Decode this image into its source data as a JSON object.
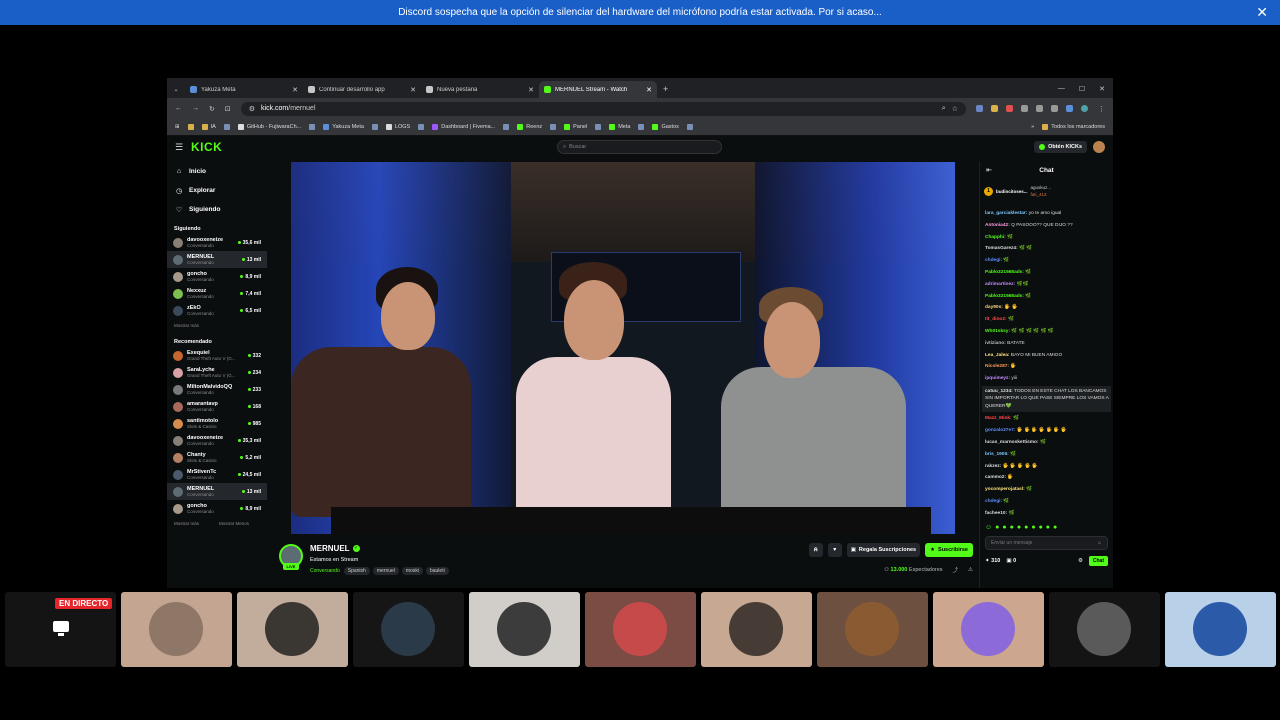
{
  "banner": {
    "text": "Discord sospecha que la opción de silenciar del hardware del micrófono podría estar activada. Por si acaso...",
    "close": "✕"
  },
  "browser": {
    "tabs": [
      {
        "label": "Yakuza Meta",
        "color": "#5b8fd9"
      },
      {
        "label": "Continuar desarrollo app",
        "color": "#c6c6c6"
      },
      {
        "label": "Nueva pestaña",
        "color": "#c6c6c6"
      },
      {
        "label": "MERNUEL Stream - Watch",
        "color": "#53fc18"
      }
    ],
    "tab_close": "✕",
    "new_tab": "+",
    "url": {
      "host": "kick.com",
      "path": "/mernuel"
    },
    "nav": {
      "back": "←",
      "forward": "→",
      "reload": "↻",
      "layout": "⊡",
      "menu": "⋮",
      "zoom": "⌕",
      "star": "☆"
    },
    "win": {
      "min": "—",
      "max": "☐",
      "close": "✕"
    },
    "bookmarks": [
      {
        "label": "IA",
        "color": "#d9b04a"
      },
      {
        "label": "GitHub - FujiwaraCh...",
        "color": "#ddd"
      },
      {
        "label": "Yakuza Meta",
        "color": "#5b8fd9"
      },
      {
        "label": "LOGS",
        "color": "#ddd"
      },
      {
        "label": "Dashboard | Fivema...",
        "color": "#9b59ff"
      },
      {
        "label": "Reenz",
        "color": "#53fc18"
      },
      {
        "label": "Panel",
        "color": "#53fc18"
      },
      {
        "label": "Meta",
        "color": "#53fc18"
      },
      {
        "label": "Gastos",
        "color": "#53fc18"
      }
    ],
    "bookmarks_all": "Todos los marcadores"
  },
  "kick": {
    "logo": "KICK",
    "search_placeholder": "Buscar",
    "get_kicks": "Obtén KICKs",
    "nav": [
      {
        "icon": "⌂",
        "label": "Inicio"
      },
      {
        "icon": "◷",
        "label": "Explorar"
      },
      {
        "icon": "♡",
        "label": "Siguiendo"
      }
    ],
    "following_title": "Siguiendo",
    "following": [
      {
        "name": "davooxeneize",
        "game": "Conversando",
        "viewers": "35,6 mil",
        "color": "#8a7f75",
        "active": false
      },
      {
        "name": "MERNUEL",
        "game": "Conversando",
        "viewers": "13 mil",
        "color": "#5d6b73",
        "active": true
      },
      {
        "name": "goncho",
        "game": "Conversando",
        "viewers": "8,9 mil",
        "color": "#a6988b",
        "active": false
      },
      {
        "name": "Nexxuz",
        "game": "Conversando",
        "viewers": "7,4 mil",
        "color": "#7fbf4d",
        "active": false
      },
      {
        "name": "zEkO",
        "game": "Conversando",
        "viewers": "6,5 mil",
        "color": "#3a4a5a",
        "active": false
      }
    ],
    "following_more": "Mostrar más",
    "recommended_title": "Recomendado",
    "recommended": [
      {
        "name": "Exequiel",
        "game": "Grand Theft Auto V (G...",
        "viewers": "332",
        "color": "#c4662e",
        "active": false
      },
      {
        "name": "SaraLyche",
        "game": "Grand Theft Auto V (G...",
        "viewers": "234",
        "color": "#d9a0a6",
        "active": false
      },
      {
        "name": "MiltonMalvidoQQ",
        "game": "Conversando",
        "viewers": "233",
        "color": "#7a7a7a",
        "active": false
      },
      {
        "name": "amarantavp",
        "game": "Conversando",
        "viewers": "168",
        "color": "#a8695b",
        "active": false
      },
      {
        "name": "santimotolo",
        "game": "Slots & Casino",
        "viewers": "985",
        "color": "#d88b4f",
        "active": false
      },
      {
        "name": "davooxeneize",
        "game": "Conversando",
        "viewers": "35,3 mil",
        "color": "#8a7f75",
        "active": false
      },
      {
        "name": "Chanty",
        "game": "Slots & Casino",
        "viewers": "5,2 mil",
        "color": "#b57f63",
        "active": false
      },
      {
        "name": "MrStivenTc",
        "game": "Conversando",
        "viewers": "24,5 mil",
        "color": "#4a5a6a",
        "active": false
      },
      {
        "name": "MERNUEL",
        "game": "Conversando",
        "viewers": "13 mil",
        "color": "#5d6b73",
        "active": true
      },
      {
        "name": "goncho",
        "game": "Conversando",
        "viewers": "8,9 mil",
        "color": "#a6988b",
        "active": false
      }
    ],
    "show_more": "Mostrar más",
    "show_less": "Mostrar Menos"
  },
  "stream": {
    "channel": "MERNUEL",
    "verified": "✓",
    "live_badge": "LIVE",
    "title": "Estamos en Stream",
    "category": "Conversando",
    "tags": [
      "Spanish",
      "mernuel",
      "moski",
      "bauleti"
    ],
    "gift_subs": "Regala Suscripciones",
    "subscribe": "Suscribirse",
    "viewers": "13.000",
    "viewers_label": "Espectadores",
    "share_icon": "⤴",
    "report_icon": "⚠",
    "bell_icon": "🔔",
    "heart_icon": "♥"
  },
  "chat": {
    "title": "Chat",
    "collapse_icon": "⇤",
    "pinned": [
      {
        "user": "budincitoses...",
        "rank": "1",
        "color": "#e9a800"
      },
      {
        "user": "aguskuz...",
        "rank": "2",
        "color": "#bbb"
      },
      {
        "user": "fati_412",
        "rank": "3",
        "color": "#d9754a"
      }
    ],
    "messages": [
      {
        "user": "lara_garciaklestar:",
        "text": "yo te amo igual",
        "color": "#7ac7ff",
        "multi": false
      },
      {
        "user": "Antonia42:",
        "text": "Q PASOOO?? QUE DIJO ??",
        "color": "#ff9de2",
        "multi": false
      },
      {
        "user": "Chapphi:",
        "text": "🌿",
        "color": "#53fc18",
        "multi": false
      },
      {
        "user": "TomasGarez4:",
        "text": "🌿 🌿",
        "color": "#ddd",
        "multi": false
      },
      {
        "user": "chdegi:",
        "text": "🌿",
        "color": "#5b8fff",
        "multi": false
      },
      {
        "user": "Pablo321568ads:",
        "text": "🌿",
        "color": "#53fc18",
        "multi": false
      },
      {
        "user": "adrimartinez:",
        "text": "🌿🌿",
        "color": "#c58cff",
        "multi": false
      },
      {
        "user": "Pablo321568ads:",
        "text": "🌿",
        "color": "#53fc18",
        "multi": false
      },
      {
        "user": "day90s:",
        "text": "🖐 🖐",
        "color": "#ffd27a",
        "multi": false
      },
      {
        "user": "tit_dino2:",
        "text": "🌿",
        "color": "#ff4a4a",
        "multi": false
      },
      {
        "user": "Wh01sksy:",
        "text": "🌿 🌿 🌿 🌿 🌿 🌿",
        "color": "#53fc18",
        "multi": false
      },
      {
        "user": "ivtiziano:",
        "text": "BATATE",
        "color": "#bbb",
        "multi": false
      },
      {
        "user": "Lea_Jalea:",
        "text": "BAYO MI BUEN AMIGO",
        "color": "#ffe27a",
        "multi": false
      },
      {
        "user": "Nicole287:",
        "text": "🖐",
        "color": "#ff9a5b",
        "multi": false
      },
      {
        "user": "ipquimeyz:",
        "text": "yiii",
        "color": "#c58cff",
        "multi": false
      },
      {
        "user": "catuu_1234:",
        "text": "TODOS EN ESTE CHAT LOS BANCAMOS SIN IMPORTAR LO QUE PASE SIEMPRE LOS VAMOS A QUERER💚",
        "color": "#ddd",
        "multi": true
      },
      {
        "user": "Mazz_Mink:",
        "text": "🌿",
        "color": "#ff4a4a",
        "multi": false
      },
      {
        "user": "gonzalo37e7:",
        "text": "🖐 🖐 🖐 🖐 🖐 🖐 🖐",
        "color": "#5b8fff",
        "multi": false
      },
      {
        "user": "lucas_marnoskettismo:",
        "text": "🌿",
        "color": "#ddd",
        "multi": false
      },
      {
        "user": "bris_1905:",
        "text": "🌿",
        "color": "#7ac7ff",
        "multi": false
      },
      {
        "user": "rakzez:",
        "text": "🖐 🖐 🖐 🖐 🖐",
        "color": "#ddd",
        "multi": false
      },
      {
        "user": "cammo2:",
        "text": "🖐",
        "color": "#ddd",
        "multi": false
      },
      {
        "user": "yocomperojatasl:",
        "text": "🌿",
        "color": "#ffe27a",
        "multi": false
      },
      {
        "user": "chdegi:",
        "text": "🌿",
        "color": "#5b8fff",
        "multi": false
      },
      {
        "user": "fachee10:",
        "text": "🌿",
        "color": "#ddd",
        "multi": false
      }
    ],
    "emote_bar": [
      "☺",
      "●",
      "●",
      "●",
      "●",
      "●",
      "●",
      "●",
      "●",
      "●"
    ],
    "input_placeholder": "Enviar un mensaje",
    "kicks_count": "310",
    "gifts_count": "0",
    "send": "Chat",
    "gear_icon": "⚙"
  },
  "thumbnails": [
    {
      "bg": "#141414",
      "type": "live",
      "live_label": "EN DIRECTO"
    },
    {
      "bg": "#c4a592",
      "circle": "#8f7768"
    },
    {
      "bg": "#c2ad9d",
      "circle": "#3a3632"
    },
    {
      "bg": "#161616",
      "circle": "#2a3a48"
    },
    {
      "bg": "#d1cec9",
      "circle": "#3c3c3c"
    },
    {
      "bg": "#7a4c44",
      "circle": "#c74a4a"
    },
    {
      "bg": "#c7a993",
      "circle": "#463c35"
    },
    {
      "bg": "#6e5040",
      "circle": "#8a5a32"
    },
    {
      "bg": "#cda68f",
      "circle": "#8c6bd9"
    },
    {
      "bg": "#141414",
      "circle": "#5a5a5a"
    },
    {
      "bg": "#b8d0e8",
      "circle": "#2a5aa8"
    }
  ]
}
